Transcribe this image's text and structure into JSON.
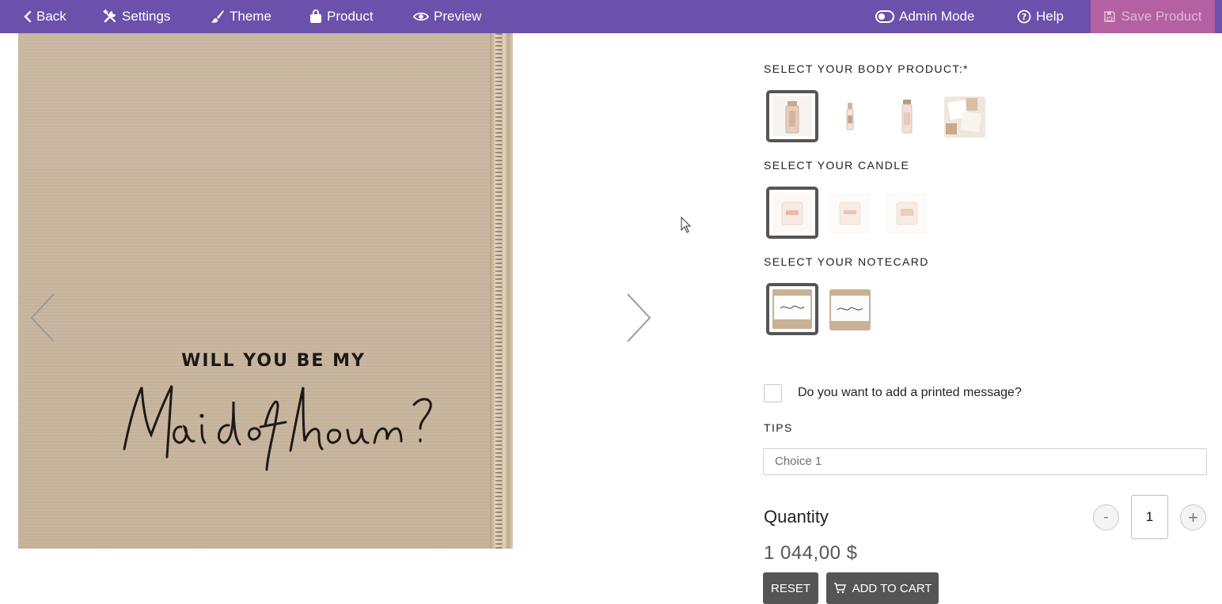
{
  "toolbar": {
    "back_label": "Back",
    "settings_label": "Settings",
    "theme_label": "Theme",
    "product_label": "Product",
    "preview_label": "Preview",
    "admin_mode_label": "Admin Mode",
    "help_label": "Help",
    "save_label": "Save Product"
  },
  "gallery": {
    "line1": "WILL YOU BE MY",
    "script_text": "Maid of honour?"
  },
  "options": {
    "body_product": {
      "label": "SELECT YOUR BODY PRODUCT:*",
      "selected_index": 0,
      "count": 4
    },
    "candle": {
      "label": "SELECT YOUR CANDLE",
      "selected_index": 0,
      "count": 3
    },
    "notecard": {
      "label": "SELECT YOUR NOTECARD",
      "selected_index": 0,
      "count": 2
    }
  },
  "printed_message": {
    "label": "Do you want to add a printed message?",
    "checked": false
  },
  "tips": {
    "label": "TIPS",
    "value": "Choice 1"
  },
  "quantity": {
    "label": "Quantity",
    "value": "1",
    "minus": "-",
    "plus": "+"
  },
  "price": "1 044,00 $",
  "actions": {
    "reset_label": "RESET",
    "add_to_cart_label": "ADD TO CART"
  },
  "colors": {
    "toolbar": "#6b51ab",
    "save_button": "#b460a3",
    "action_button": "#555555"
  }
}
